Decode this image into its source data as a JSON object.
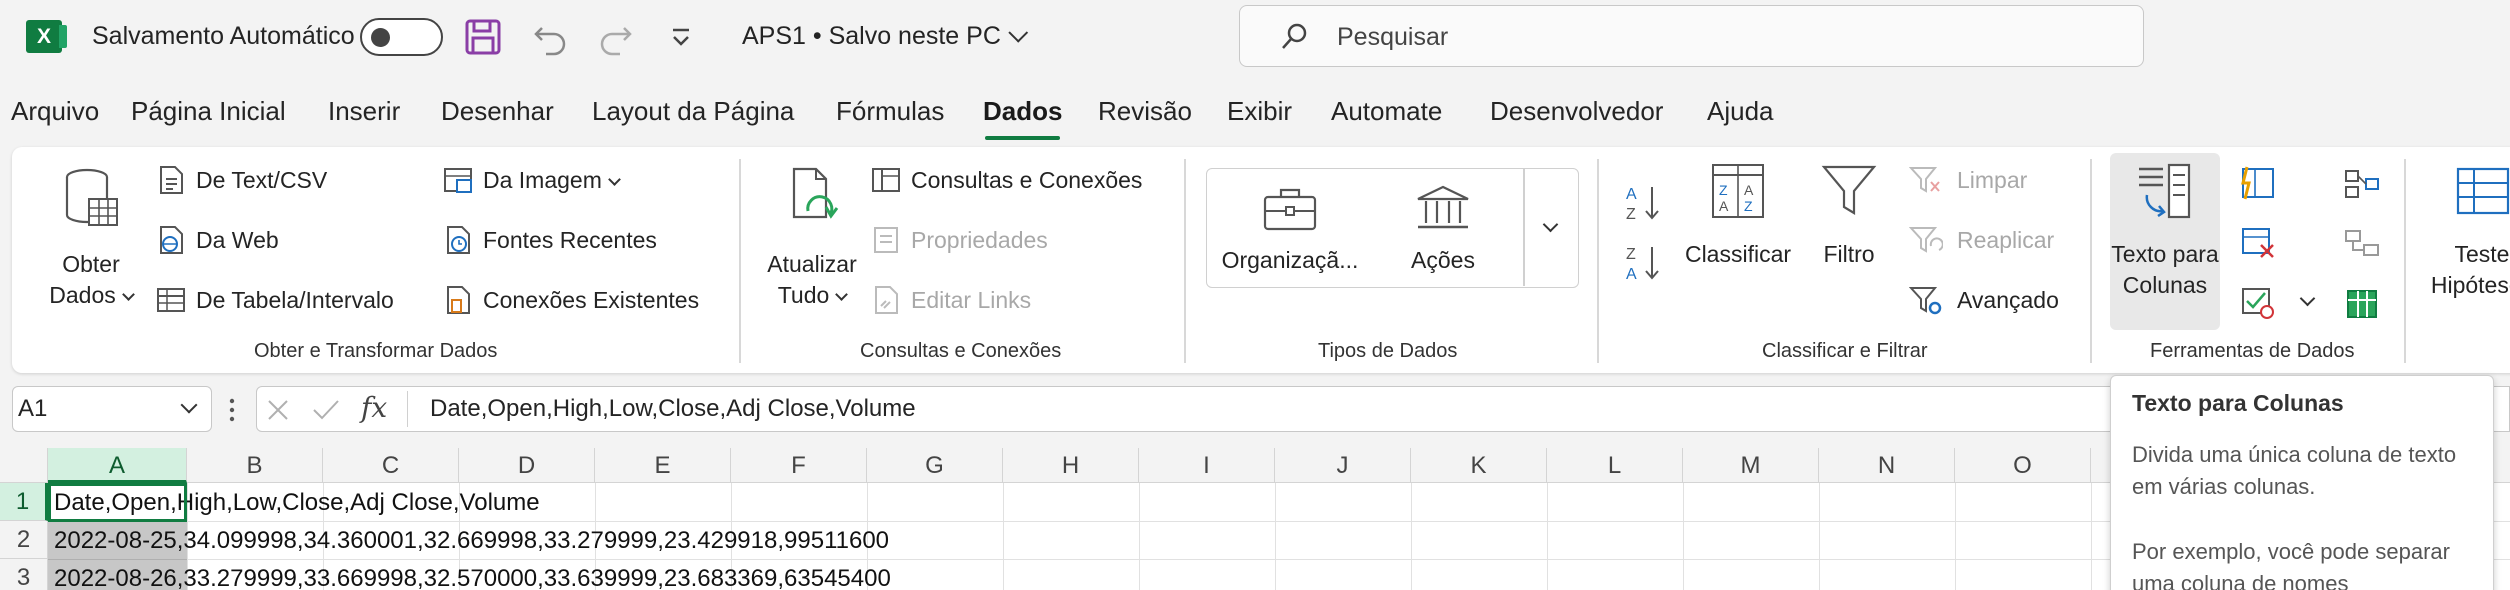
{
  "titlebar": {
    "app_icon": "excel-icon",
    "autosave_label": "Salvamento Automático",
    "autosave_state": "off",
    "doc_title": "APS1 • Salvo neste PC",
    "search_placeholder": "Pesquisar"
  },
  "menu": {
    "tabs": [
      "Arquivo",
      "Página Inicial",
      "Inserir",
      "Desenhar",
      "Layout da Página",
      "Fórmulas",
      "Dados",
      "Revisão",
      "Exibir",
      "Automate",
      "Desenvolvedor",
      "Ajuda"
    ],
    "active": "Dados"
  },
  "ribbon": {
    "obter": {
      "get_data": "Obter",
      "get_data2": "Dados",
      "from_text": "De Text/CSV",
      "from_web": "Da Web",
      "from_table": "De Tabela/Intervalo",
      "from_image": "Da Imagem",
      "recent_sources": "Fontes Recentes",
      "existing_conn": "Conexões Existentes",
      "group_label": "Obter e Transformar Dados"
    },
    "consultas": {
      "refresh": "Atualizar",
      "refresh2": "Tudo",
      "queries": "Consultas e Conexões",
      "properties": "Propriedades",
      "edit_links": "Editar Links",
      "group_label": "Consultas e Conexões"
    },
    "tipos": {
      "org": "Organizaçã...",
      "stocks": "Ações",
      "group_label": "Tipos de Dados"
    },
    "classificar": {
      "sort": "Classificar",
      "filter": "Filtro",
      "clear": "Limpar",
      "reapply": "Reaplicar",
      "advanced": "Avançado",
      "group_label": "Classificar e Filtrar"
    },
    "ferramentas": {
      "text_to_cols": "Texto para",
      "text_to_cols2": "Colunas",
      "group_label": "Ferramentas de Dados"
    },
    "previsao": {
      "whatif": "Teste",
      "whatif2": "Hipóteses"
    }
  },
  "formula_bar": {
    "name_box": "A1",
    "formula": "Date,Open,High,Low,Close,Adj Close,Volume"
  },
  "grid": {
    "columns": [
      "A",
      "B",
      "C",
      "D",
      "E",
      "F",
      "G",
      "H",
      "I",
      "J",
      "K",
      "L",
      "M",
      "N",
      "O"
    ],
    "rows": [
      "1",
      "2",
      "3"
    ],
    "cells": [
      "Date,Open,High,Low,Close,Adj Close,Volume",
      "2022-08-25,34.099998,34.360001,32.669998,33.279999,23.429918,99511600",
      "2022-08-26,33.279999,33.669998,32.570000,33.639999,23.683369,63545400"
    ]
  },
  "tooltip": {
    "title": "Texto para Colunas",
    "p1": "Divida uma única coluna de texto em várias colunas.",
    "p2": "Por exemplo, você pode separar uma coluna de nomes"
  }
}
